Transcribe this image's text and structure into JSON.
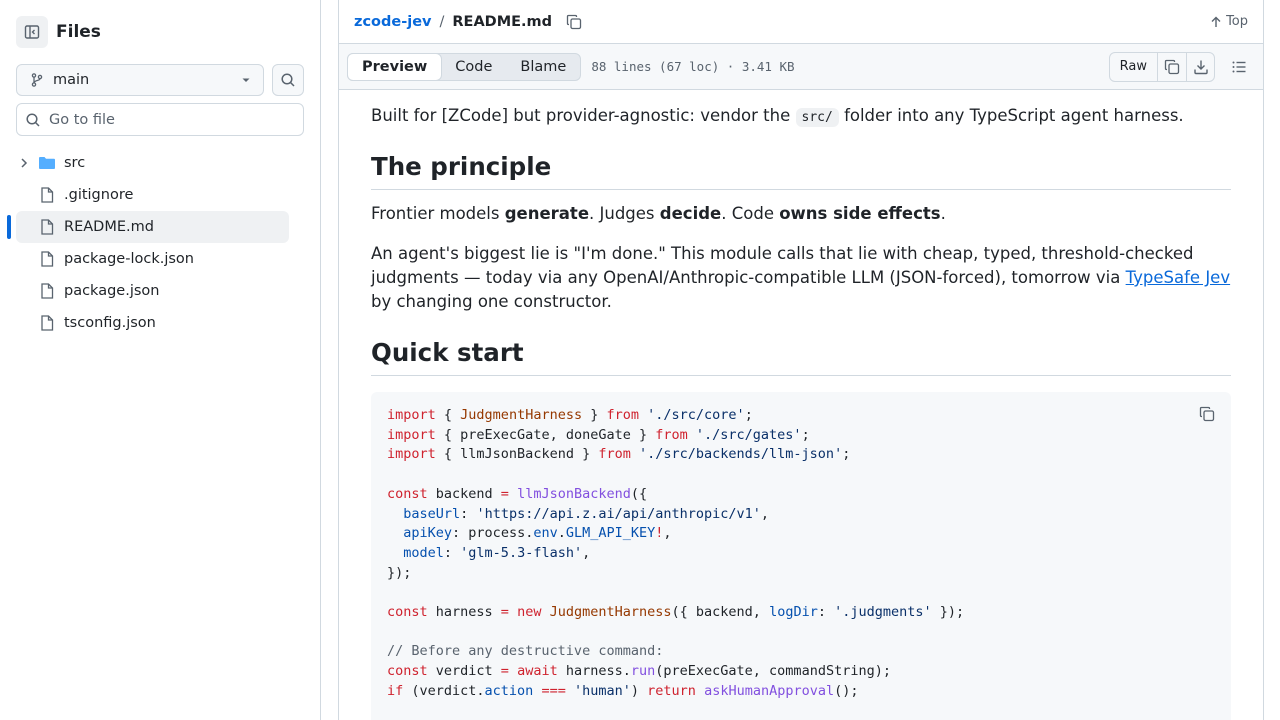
{
  "sidebar": {
    "title": "Files",
    "branch": "main",
    "goto_placeholder": "Go to file",
    "items": [
      {
        "name": "src",
        "type": "folder"
      },
      {
        "name": ".gitignore",
        "type": "file"
      },
      {
        "name": "README.md",
        "type": "file",
        "active": true
      },
      {
        "name": "package-lock.json",
        "type": "file"
      },
      {
        "name": "package.json",
        "type": "file"
      },
      {
        "name": "tsconfig.json",
        "type": "file"
      }
    ]
  },
  "header": {
    "repo": "zcode-jev",
    "separator": "/",
    "file": "README.md",
    "top_label": "Top"
  },
  "toolbar": {
    "tabs": [
      "Preview",
      "Code",
      "Blame"
    ],
    "selected_tab": "Preview",
    "meta": "88 lines (67 loc) · 3.41 KB",
    "raw_label": "Raw"
  },
  "readme": {
    "intro_before": "Built for [ZCode] but provider-agnostic: vendor the ",
    "intro_code": "src/",
    "intro_after": " folder into any TypeScript agent harness.",
    "h_principle": "The principle",
    "principle": {
      "t1": "Frontier models ",
      "b1": "generate",
      "t2": ". Judges ",
      "b2": "decide",
      "t3": ". Code ",
      "b3": "owns side effects",
      "t4": "."
    },
    "para3_before": "An agent's biggest lie is \"I'm done.\" This module calls that lie with cheap, typed, threshold-checked judgments — today via any OpenAI/Anthropic-compatible LLM (JSON-forced), tomorrow via ",
    "para3_link": "TypeSafe Jev",
    "para3_after": " by changing one constructor.",
    "h_quick": "Quick start"
  },
  "colors": {
    "accent": "#0969da",
    "keyword": "#cf222e",
    "string": "#0a3069",
    "function": "#8250df",
    "class": "#953800",
    "property": "#0550ae",
    "comment": "#59636e"
  },
  "icons": [
    "sidebar-collapse-icon",
    "git-branch-icon",
    "chevron-down-icon",
    "search-icon",
    "chevron-right-icon",
    "folder-icon",
    "file-icon",
    "copy-icon",
    "arrow-up-icon",
    "download-icon",
    "list-unordered-icon"
  ]
}
